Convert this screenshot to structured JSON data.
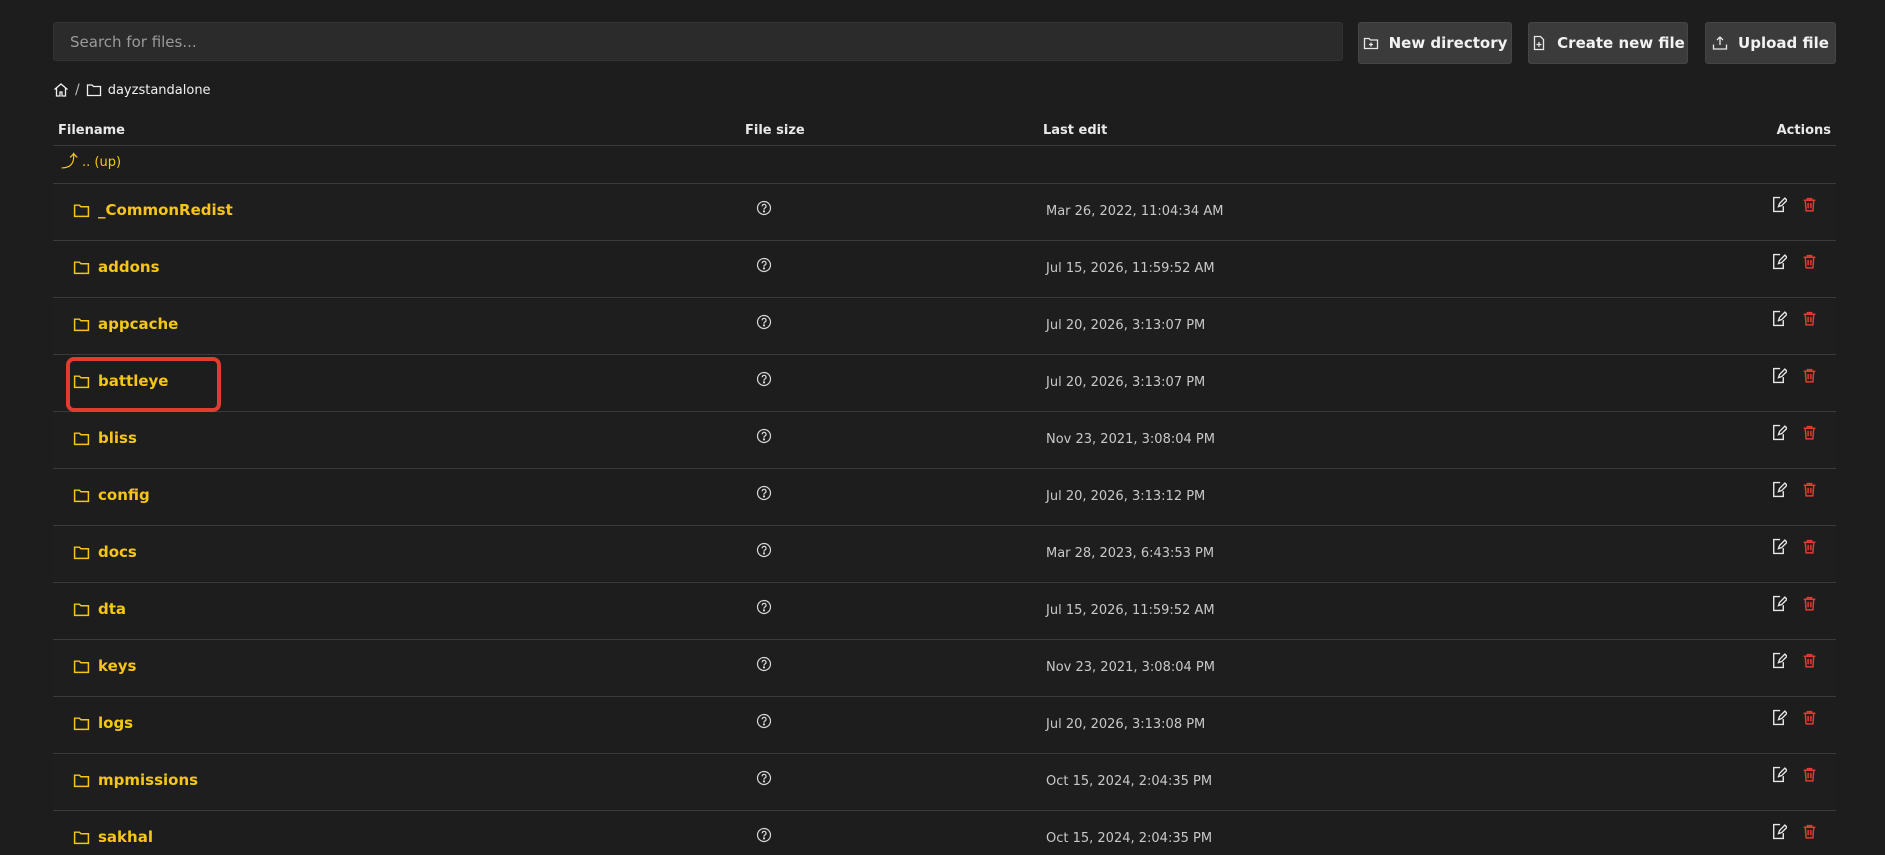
{
  "search": {
    "placeholder": "Search for files..."
  },
  "toolbar": {
    "new_directory": "New directory",
    "create_new_file": "Create new file",
    "upload_file": "Upload file"
  },
  "breadcrumb": {
    "home_icon": "home-icon",
    "separator": "/",
    "folder_icon": "folder-icon",
    "current": "dayzstandalone"
  },
  "table": {
    "headers": {
      "filename": "Filename",
      "file_size": "File size",
      "last_edit": "Last edit",
      "actions": "Actions"
    },
    "up_label": ".. (up)",
    "rows": [
      {
        "name": "_CommonRedist",
        "last_edit": "Mar 26, 2022, 11:04:34 AM"
      },
      {
        "name": "addons",
        "last_edit": "Jul 15, 2026, 11:59:52 AM"
      },
      {
        "name": "appcache",
        "last_edit": "Jul 20, 2026, 3:13:07 PM"
      },
      {
        "name": "battleye",
        "last_edit": "Jul 20, 2026, 3:13:07 PM"
      },
      {
        "name": "bliss",
        "last_edit": "Nov 23, 2021, 3:08:04 PM"
      },
      {
        "name": "config",
        "last_edit": "Jul 20, 2026, 3:13:12 PM"
      },
      {
        "name": "docs",
        "last_edit": "Mar 28, 2023, 6:43:53 PM"
      },
      {
        "name": "dta",
        "last_edit": "Jul 15, 2026, 11:59:52 AM"
      },
      {
        "name": "keys",
        "last_edit": "Nov 23, 2021, 3:08:04 PM"
      },
      {
        "name": "logs",
        "last_edit": "Jul 20, 2026, 3:13:08 PM"
      },
      {
        "name": "mpmissions",
        "last_edit": "Oct 15, 2024, 2:04:35 PM"
      },
      {
        "name": "sakhal",
        "last_edit": "Oct 15, 2024, 2:04:35 PM"
      }
    ]
  },
  "colors": {
    "accent": "#f5c518",
    "danger": "#e03c31",
    "background": "#1d1d1d"
  }
}
